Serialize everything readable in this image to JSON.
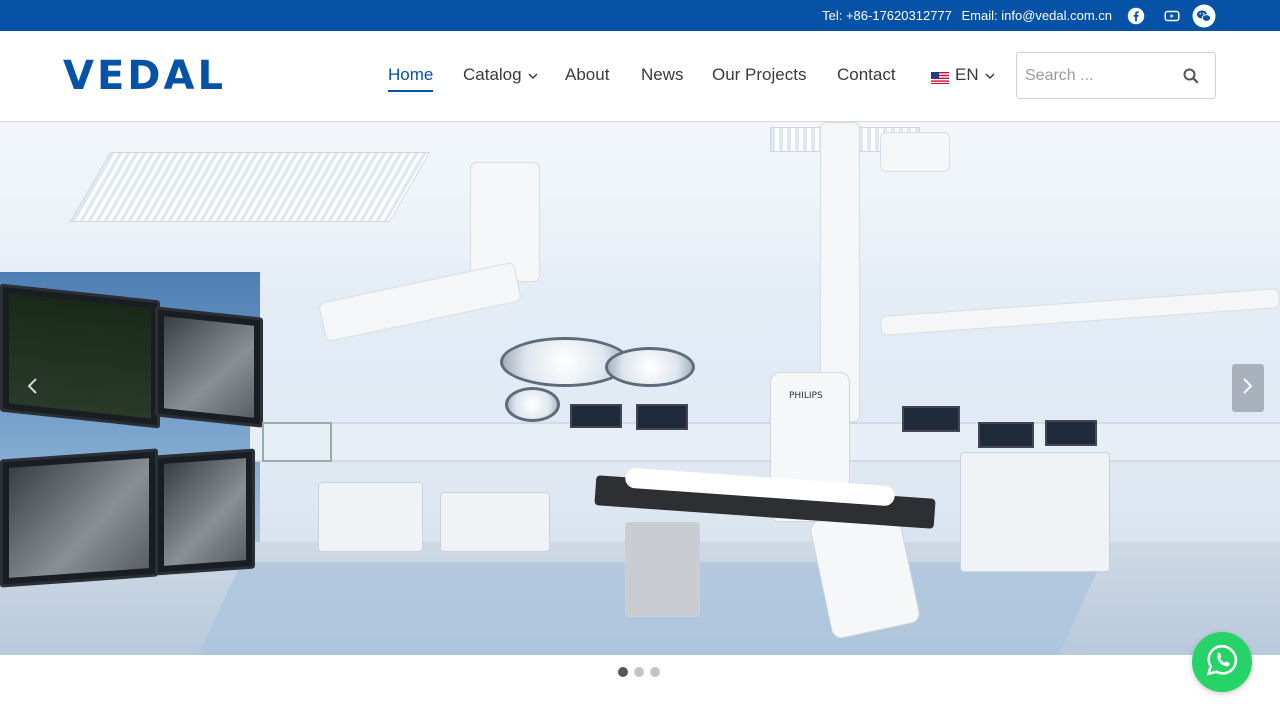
{
  "topbar": {
    "tel": "Tel: +86-17620312777",
    "email": "Email: info@vedal.com.cn",
    "social": [
      "facebook-icon",
      "youtube-icon",
      "wechat-icon"
    ]
  },
  "header": {
    "logo": "VEDAL",
    "nav": [
      {
        "label": "Home",
        "active": true
      },
      {
        "label": "Catalog",
        "dropdown": true
      },
      {
        "label": "About"
      },
      {
        "label": "News"
      },
      {
        "label": "Our Projects"
      },
      {
        "label": "Contact"
      }
    ],
    "language": {
      "label": "EN",
      "flag": "us-flag-icon"
    },
    "search": {
      "placeholder": "Search ..."
    }
  },
  "hero": {
    "slides_total": 3,
    "active_slide": 1,
    "monitor_label": "PHILIPS"
  },
  "colors": {
    "brand": "#0652a6",
    "whatsapp": "#25d366"
  }
}
